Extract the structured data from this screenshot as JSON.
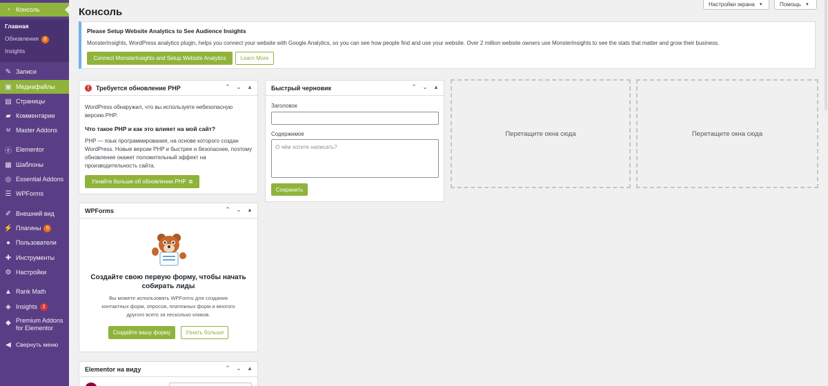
{
  "sidebar": {
    "dashboard": "Консоль",
    "submenu": {
      "home": "Главная",
      "updates": "Обновления",
      "updates_count": "6",
      "insights": "Insights"
    },
    "posts": "Записи",
    "media": "Медиафайлы",
    "pages": "Страницы",
    "comments": "Комментарии",
    "master_addons": "Master Addons",
    "elementor": "Elementor",
    "templates": "Шаблоны",
    "essential_addons": "Essential Addons",
    "wpforms": "WPForms",
    "appearance": "Внешний вид",
    "plugins": "Плагины",
    "plugins_count": "5",
    "users": "Пользователи",
    "tools": "Инструменты",
    "settings": "Настройки",
    "rank_math": "Rank Math",
    "insights": "Insights",
    "insights_count": "2",
    "premium_addons_1": "Premium Addons",
    "premium_addons_2": "for Elementor",
    "collapse": "Свернуть меню"
  },
  "header": {
    "title": "Консоль",
    "screen_options": "Настройки экрана",
    "help": "Помощь"
  },
  "notice": {
    "title": "Please Setup Website Analytics to See Audience Insights",
    "text": "MonsterInsights, WordPress analytics plugin, helps you connect your website with Google Analytics, so you can see how people find and use your website. Over 2 million website owners use MonsterInsights to see the stats that matter and grow their business.",
    "connect_button": "Connect MonsterInsights and Setup Website Analytics",
    "learn_more_button": "Learn More"
  },
  "php_box": {
    "title": "Требуется обновление PHP",
    "line1": "WordPress обнаружил, что вы используете небезопасную",
    "line2": "версию PHP.",
    "heading": "Что такое PHP и как это влияет на мой сайт?",
    "p1": "PHP — язык программирования, на основе которого создан",
    "p2": "WordPress. Новые версии PHP и быстрее и безопаснее, поэтому",
    "p3": "обновление окажет положительный эффект на",
    "p4": "производительность сайта.",
    "button": "Узнайте больше об обновлении PHP"
  },
  "draft_box": {
    "title": "Быстрый черновик",
    "title_label": "Заголовок",
    "content_label": "Содержимое",
    "content_placeholder": "О чём хотите написать?",
    "save_button": "Сохранить"
  },
  "dropzones": {
    "label": "Перетащите окна сюда"
  },
  "wpforms_box": {
    "title": "WPForms",
    "heading1": "Создайте свою первую форму, чтобы начать",
    "heading2": "собирать лиды",
    "text1": "Вы можете использовать WPForms для создания",
    "text2": "контактных форм, опросов, платежных форм и многого",
    "text3": "другого всего за несколько кликов.",
    "create_button": "Создайте вашу форму",
    "learn_button": "Узнать больше"
  },
  "elementor_box": {
    "title": "Elementor на виду"
  },
  "box_controls": {
    "up": "⌃",
    "down": "⌄",
    "toggle": "▴"
  },
  "colors": {
    "sidebar": "#5a3e85",
    "accent": "#8fb33b",
    "notice_border": "#72aee6"
  }
}
